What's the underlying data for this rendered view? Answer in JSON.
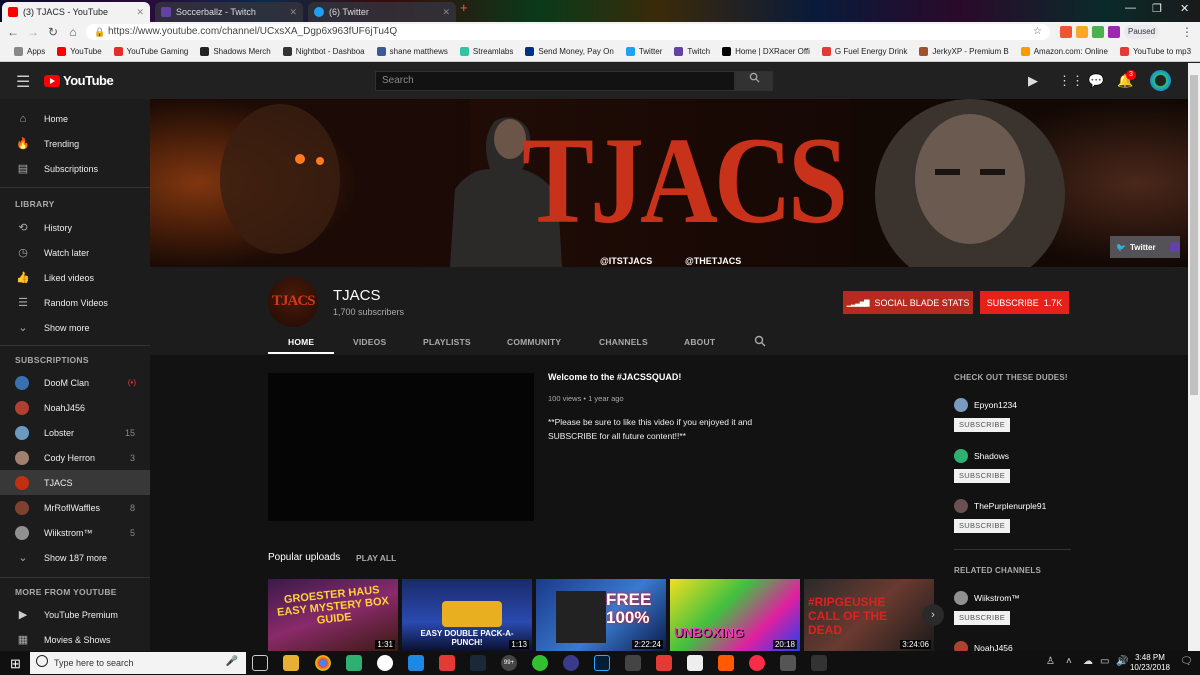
{
  "browser": {
    "tabs": [
      {
        "title": "(3) TJACS - YouTube",
        "icon": "youtube-icon",
        "active": true
      },
      {
        "title": "Soccerballz - Twitch",
        "icon": "twitch-icon",
        "active": false
      },
      {
        "title": "(6) Twitter",
        "icon": "twitter-icon",
        "active": false
      }
    ],
    "new_tab": "+",
    "url": "https://www.youtube.com/channel/UCxsXA_Dgp6x963fUF6jTu4Q",
    "profile_status": "Paused",
    "bookmarks": [
      {
        "label": "Apps",
        "icon": "apps-icon"
      },
      {
        "label": "YouTube",
        "icon": "youtube-icon"
      },
      {
        "label": "YouTube Gaming",
        "icon": "youtube-gaming-icon"
      },
      {
        "label": "Shadows Merch",
        "icon": "shadows-icon"
      },
      {
        "label": "Nightbot - Dashboa",
        "icon": "nightbot-icon"
      },
      {
        "label": "shane matthews",
        "icon": "facebook-icon"
      },
      {
        "label": "Streamlabs",
        "icon": "streamlabs-icon"
      },
      {
        "label": "Send Money, Pay On",
        "icon": "paypal-icon"
      },
      {
        "label": "Twitter",
        "icon": "twitter-icon"
      },
      {
        "label": "Twitch",
        "icon": "twitch-icon"
      },
      {
        "label": "Home | DXRacer Offi",
        "icon": "dxracer-icon"
      },
      {
        "label": "G Fuel Energy Drink",
        "icon": "gfuel-icon"
      },
      {
        "label": "JerkyXP - Premium B",
        "icon": "jerky-icon"
      },
      {
        "label": "Amazon.com: Online",
        "icon": "amazon-icon"
      },
      {
        "label": "YouTube to mp3",
        "icon": "mp3-icon"
      }
    ]
  },
  "header": {
    "logo": "YouTube",
    "search_placeholder": "Search",
    "notification_count": "3"
  },
  "sidebar": {
    "main_items": [
      {
        "label": "Home",
        "icon": "home-icon"
      },
      {
        "label": "Trending",
        "icon": "flame-icon"
      },
      {
        "label": "Subscriptions",
        "icon": "subscriptions-icon"
      }
    ],
    "library_heading": "LIBRARY",
    "library_items": [
      {
        "label": "History",
        "icon": "history-icon"
      },
      {
        "label": "Watch later",
        "icon": "clock-icon"
      },
      {
        "label": "Liked videos",
        "icon": "thumbs-up-icon"
      },
      {
        "label": "Random Videos",
        "icon": "playlist-icon"
      },
      {
        "label": "Show more",
        "icon": "chevron-down-icon"
      }
    ],
    "subscriptions_heading": "SUBSCRIPTIONS",
    "subscriptions": [
      {
        "label": "DooM Clan",
        "badge": "(•)",
        "color": "#3a6fb0"
      },
      {
        "label": "NoahJ456",
        "badge": "",
        "color": "#b04030"
      },
      {
        "label": "Lobster",
        "badge": "15",
        "color": "#6a9ac0"
      },
      {
        "label": "Cody Herron",
        "badge": "3",
        "color": "#a08070"
      },
      {
        "label": "TJACS",
        "badge": "",
        "color": "#c03010",
        "active": true
      },
      {
        "label": "MrRoflWaffles",
        "badge": "8",
        "color": "#804030"
      },
      {
        "label": "Wiikstrom™",
        "badge": "5",
        "color": "#909090"
      },
      {
        "label": "Show 187 more",
        "badge": "",
        "color": ""
      }
    ],
    "more_heading": "MORE FROM YOUTUBE",
    "more_items": [
      {
        "label": "YouTube Premium",
        "icon": "youtube-premium-icon"
      },
      {
        "label": "Movies & Shows",
        "icon": "film-icon"
      }
    ]
  },
  "banner": {
    "title_art": "TJACS",
    "handle_left": "@ITSTJACS",
    "handle_right": "@THETJACS",
    "twitter_link": "Twitter"
  },
  "channel": {
    "name": "TJACS",
    "subscribers": "1,700 subscribers",
    "avatar_text": "TJACS",
    "social_blade_label": "SOCIAL BLADE STATS",
    "subscribe_label": "SUBSCRIBE",
    "subscribe_count": "1.7K",
    "tabs": [
      "HOME",
      "VIDEOS",
      "PLAYLISTS",
      "COMMUNITY",
      "CHANNELS",
      "ABOUT"
    ]
  },
  "featured": {
    "title": "Welcome to the #JACSSQUAD!",
    "meta": "100 views • 1 year ago",
    "description": "**Please be sure to like this video if you enjoyed it and SUBSCRIBE for all future content!!**"
  },
  "popular": {
    "heading": "Popular uploads",
    "play_all": "PLAY ALL",
    "videos": [
      {
        "duration": "1:31",
        "art": "GROESTER HAUS EASY MYSTERY BOX GUIDE"
      },
      {
        "duration": "1:13",
        "art": "EASY DOUBLE PACK-A-PUNCH!"
      },
      {
        "duration": "2:22:24",
        "art": "FREE 100%"
      },
      {
        "duration": "20:18",
        "art": "UNBOXING"
      },
      {
        "duration": "3:24:06",
        "art": "#RIPGEUSHE CALL OF THE DEAD"
      }
    ]
  },
  "right_column": {
    "featured_heading": "CHECK OUT THESE DUDES!",
    "featured_channels": [
      {
        "name": "Epyon1234",
        "color": "#7a9ac0"
      },
      {
        "name": "Shadows",
        "color": "#2fb070"
      },
      {
        "name": "ThePurplenurple91",
        "color": "#6a5050"
      }
    ],
    "related_heading": "RELATED CHANNELS",
    "related_channels": [
      {
        "name": "Wiikstrom™",
        "color": "#909090"
      },
      {
        "name": "NoahJ456",
        "color": "#b04030"
      }
    ],
    "subscribe_label": "SUBSCRIBE"
  },
  "taskbar": {
    "search_placeholder": "Type here to search",
    "time": "3:48 PM",
    "date": "10/23/2018",
    "badge": "99+"
  }
}
